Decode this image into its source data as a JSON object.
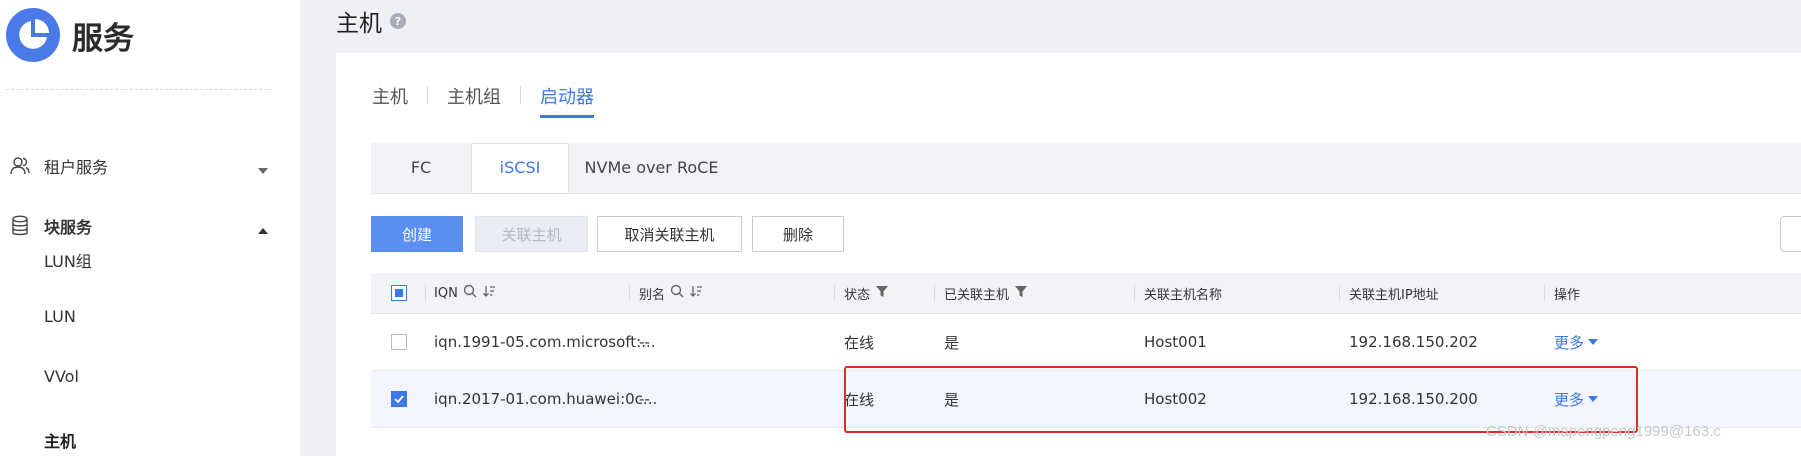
{
  "sidebar": {
    "brand": {
      "title": "服务"
    },
    "groups": [
      {
        "label": "租户服务",
        "icon": "users-icon",
        "expanded": false
      },
      {
        "label": "块服务",
        "icon": "database-icon",
        "expanded": true
      }
    ],
    "items": [
      {
        "label": "LUN组"
      },
      {
        "label": "LUN"
      },
      {
        "label": "VVol"
      },
      {
        "label": "主机",
        "active": true
      }
    ]
  },
  "page": {
    "title": "主机"
  },
  "top_tabs": [
    {
      "label": "主机"
    },
    {
      "label": "主机组"
    },
    {
      "label": "启动器",
      "active": true
    }
  ],
  "protocol_tabs": [
    {
      "label": "FC"
    },
    {
      "label": "iSCSI",
      "active": true
    },
    {
      "label": "NVMe over RoCE"
    }
  ],
  "toolbar": {
    "create": "创建",
    "associate_host": "关联主机",
    "disassociate_host": "取消关联主机",
    "delete": "删除"
  },
  "table": {
    "columns": [
      "IQN",
      "别名",
      "状态",
      "已关联主机",
      "关联主机名称",
      "关联主机IP地址",
      "操作"
    ],
    "rows": [
      {
        "iqn": "iqn.1991-05.com.microsoft:...",
        "alias": "--",
        "status": "在线",
        "associated": "是",
        "host_name": "Host001",
        "host_ip": "192.168.150.202",
        "action": "更多",
        "checked": false
      },
      {
        "iqn": "iqn.2017-01.com.huawei:0c...",
        "alias": "--",
        "status": "在线",
        "associated": "是",
        "host_name": "Host002",
        "host_ip": "192.168.150.200",
        "action": "更多",
        "checked": true
      }
    ]
  },
  "watermark": "CSDN @mapengpeng1999@163.c",
  "colors": {
    "accent": "#3c78e6",
    "primary_button": "#5b8ef0",
    "highlight": "#e02a2a"
  }
}
